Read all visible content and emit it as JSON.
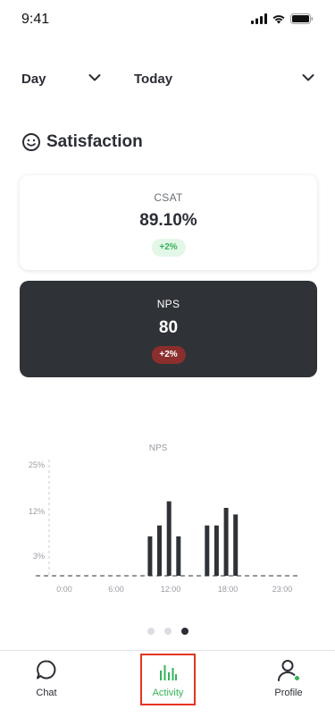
{
  "status_bar": {
    "time": "9:41"
  },
  "filters": {
    "range": {
      "label": "Day"
    },
    "date": {
      "label": "Today"
    }
  },
  "section": {
    "title": "Satisfaction"
  },
  "cards": {
    "csat": {
      "metric": "CSAT",
      "value": "89.10%",
      "change": "+2%",
      "change_color": "#34b35a"
    },
    "nps": {
      "metric": "NPS",
      "value": "80",
      "change": "+2%",
      "change_color": "#8b2e2e"
    }
  },
  "chart_data": {
    "type": "bar",
    "title": "NPS",
    "xlabel": "",
    "ylabel": "",
    "x_tick_labels": [
      "0:00",
      "6:00",
      "12:00",
      "18:00",
      "23:00"
    ],
    "y_tick_labels": [
      "3%",
      "12%",
      "25%"
    ],
    "hours": [
      0,
      1,
      2,
      3,
      4,
      5,
      6,
      7,
      8,
      9,
      10,
      11,
      12,
      13,
      14,
      15,
      16,
      17,
      18,
      19,
      20,
      21,
      22,
      23
    ],
    "values": [
      0,
      0,
      0,
      0,
      0,
      0,
      0,
      0,
      0,
      9,
      11.5,
      17,
      9,
      0,
      0,
      11.5,
      11.5,
      15.5,
      14,
      0,
      0,
      0,
      0,
      0
    ],
    "ylim": [
      0,
      25
    ],
    "bar_color": "#2f3237",
    "grid": false
  },
  "pager": {
    "count": 3,
    "active": 2
  },
  "tabbar": {
    "items": [
      {
        "label": "Chat",
        "icon": "chat-bubble-icon"
      },
      {
        "label": "Activity",
        "icon": "bar-chart-icon",
        "active": true,
        "color": "#34b35a"
      },
      {
        "label": "Profile",
        "icon": "user-icon",
        "badge_color": "#34b35a"
      }
    ]
  },
  "colors": {
    "accent": "#34b35a",
    "dark": "#2f3237",
    "negative": "#8b2e2e",
    "highlight_border": "#e63323"
  }
}
